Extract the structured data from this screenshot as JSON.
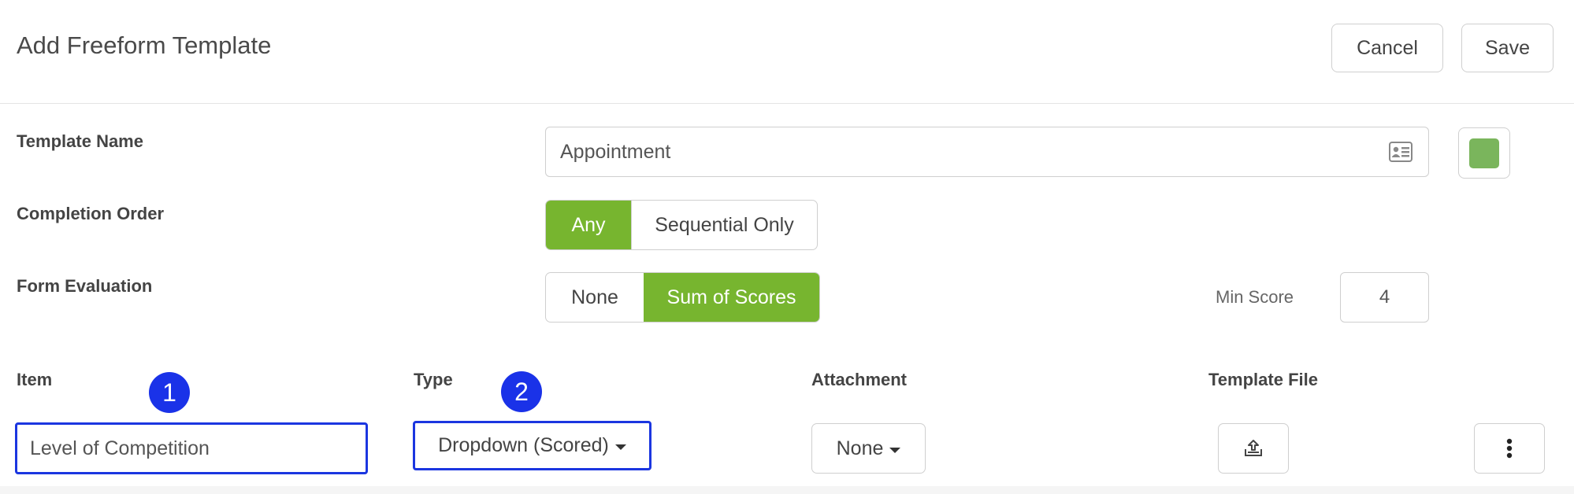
{
  "header": {
    "title": "Add Freeform Template",
    "cancel_label": "Cancel",
    "save_label": "Save"
  },
  "form": {
    "template_name": {
      "label": "Template Name",
      "value": "Appointment",
      "icon": "contact-card-icon",
      "color": "#7ab55c"
    },
    "completion_order": {
      "label": "Completion Order",
      "options": [
        "Any",
        "Sequential Only"
      ],
      "selected": "Any"
    },
    "form_evaluation": {
      "label": "Form Evaluation",
      "options": [
        "None",
        "Sum of Scores"
      ],
      "selected": "Sum of Scores"
    },
    "min_score": {
      "label": "Min Score",
      "value": "4"
    }
  },
  "items": {
    "columns": [
      "Item",
      "Type",
      "Attachment",
      "Template File"
    ],
    "row": {
      "item_value": "Level of Competition",
      "type_value": "Dropdown (Scored)",
      "attachment_value": "None",
      "template_file_icon": "upload-icon",
      "actions_icon": "more-vertical-icon"
    }
  },
  "annotations": {
    "badge_1": "1",
    "badge_2": "2"
  },
  "colors": {
    "accent_green": "#77b52f",
    "annotation_blue": "#1b36e0"
  }
}
